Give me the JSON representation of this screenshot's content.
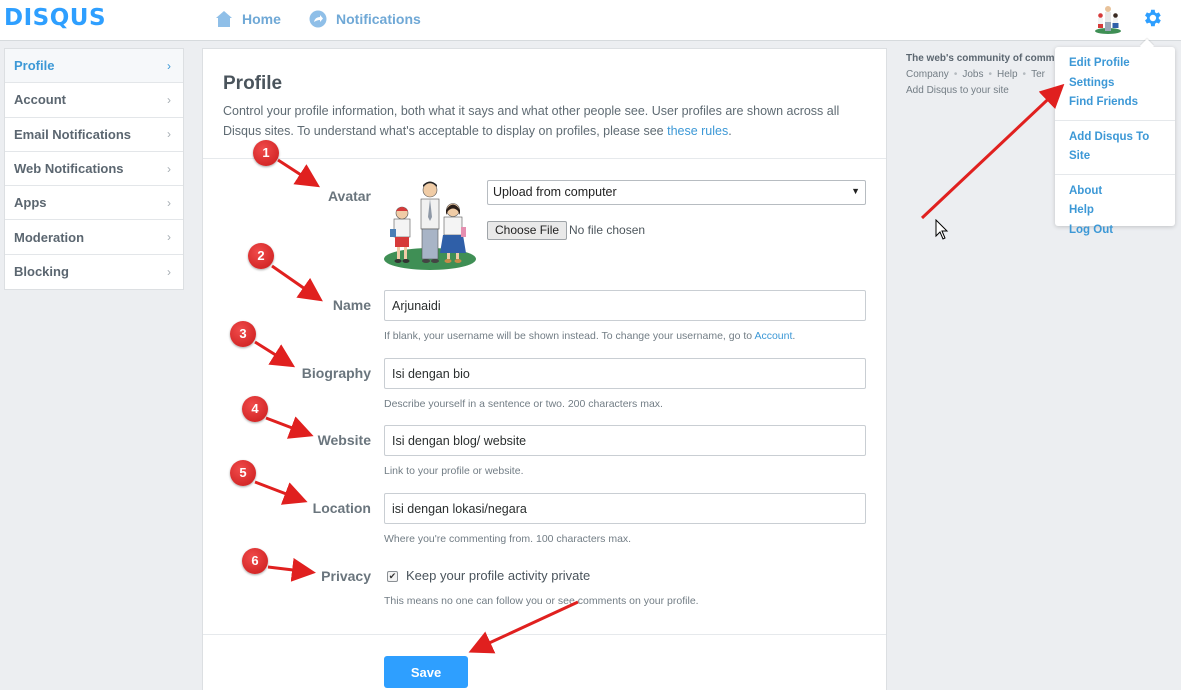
{
  "topnav": {
    "logo": "DISQUS",
    "home_label": "Home",
    "notifications_label": "Notifications",
    "home_icon": "home-icon",
    "notifications_icon": "notification-icon",
    "settings_icon": "gear-icon",
    "brand_color": "#2e9fff"
  },
  "sidebar": {
    "items": [
      {
        "label": "Profile",
        "active": true
      },
      {
        "label": "Account",
        "active": false
      },
      {
        "label": "Email Notifications",
        "active": false
      },
      {
        "label": "Web Notifications",
        "active": false
      },
      {
        "label": "Apps",
        "active": false
      },
      {
        "label": "Moderation",
        "active": false
      },
      {
        "label": "Blocking",
        "active": false
      }
    ],
    "chevron": "›"
  },
  "main": {
    "title": "Profile",
    "description": "Control your profile information, both what it says and what other people see. User profiles are shown across all Disqus sites. To understand what's acceptable to display on profiles, please see ",
    "rules_link": "these rules",
    "rules_suffix": ".",
    "avatar": {
      "label": "Avatar",
      "source_selected": "Upload from computer",
      "choose_file_label": "Choose File",
      "file_status": "No file chosen"
    },
    "name": {
      "label": "Name",
      "value": "Arjunaidi",
      "help_prefix": "If blank, your username will be shown instead. To change your username, go to ",
      "help_link": "Account",
      "help_suffix": "."
    },
    "biography": {
      "label": "Biography",
      "value": "Isi dengan bio",
      "help": "Describe yourself in a sentence or two. 200 characters max."
    },
    "website": {
      "label": "Website",
      "value": "Isi dengan blog/ website",
      "help": "Link to your profile or website."
    },
    "location": {
      "label": "Location",
      "value": "isi dengan lokasi/negara",
      "help": "Where you're commenting from. 100 characters max."
    },
    "privacy": {
      "label": "Privacy",
      "checkbox_label": "Keep your profile activity private",
      "checked": true,
      "check_glyph": "✔",
      "help": "This means no one can follow you or see comments on your profile."
    },
    "save_label": "Save"
  },
  "right_footer": {
    "tagline": "The web's community of commu",
    "links": [
      "Company",
      "Jobs",
      "Help",
      "Ter"
    ],
    "separator": "•",
    "add_disqus": "Add Disqus to your site"
  },
  "dropdown": {
    "group1": [
      "Edit Profile",
      "Settings",
      "Find Friends"
    ],
    "group2": [
      "Add Disqus To Site"
    ],
    "group3": [
      "About",
      "Help",
      "Log Out"
    ]
  },
  "annotations": {
    "markers": [
      "1",
      "2",
      "3",
      "4",
      "5",
      "6"
    ],
    "color": "#e0201f"
  }
}
